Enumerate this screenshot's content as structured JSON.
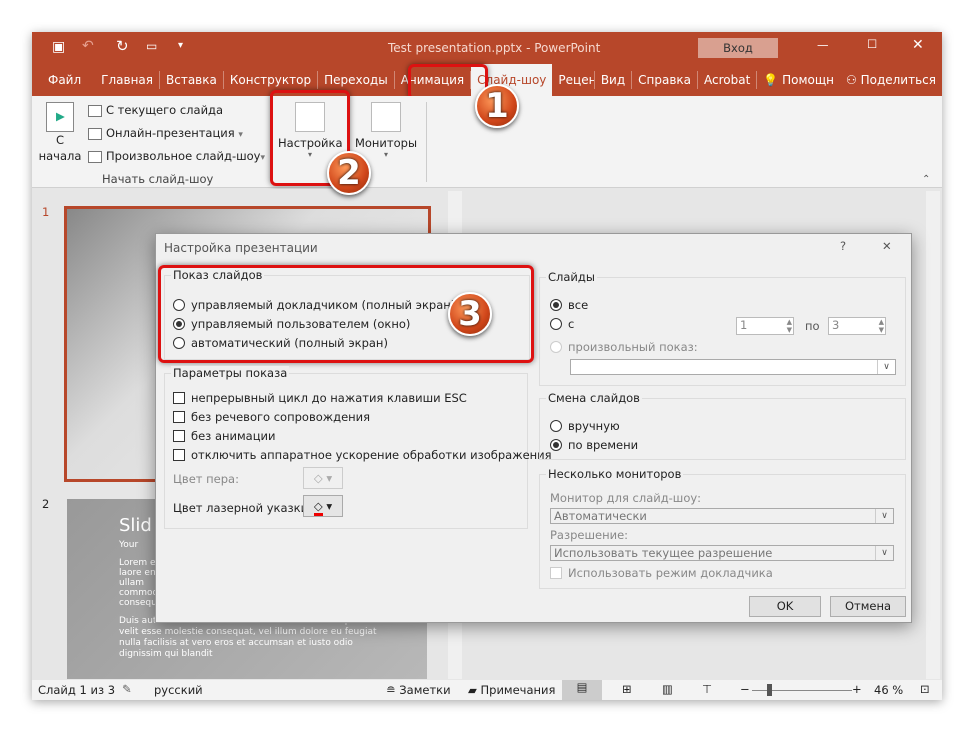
{
  "window": {
    "title": "Test presentation.pptx  -  PowerPoint",
    "login_button": "Вход"
  },
  "tabs": [
    "Файл",
    "Главная",
    "Вставка",
    "Конструктор",
    "Переходы",
    "Анимация",
    "Слайд-шоу",
    "Рецензирование",
    "Вид",
    "Справка",
    "Acrobat",
    "Помощн",
    "Поделиться"
  ],
  "ribbon": {
    "from_start": "С начала",
    "from_current": "С текущего слайда",
    "online": "Онлайн-презентация",
    "custom": "Произвольное слайд-шоу",
    "group_label": "Начать слайд-шоу",
    "setup": "Настройка",
    "monitors": "Мониторы"
  },
  "badges": [
    "1",
    "2",
    "3"
  ],
  "thumbs": {
    "n1": "1",
    "n2": "2",
    "slide2_title": "Slid",
    "slide2_b1": "Your",
    "slide2_b2": "Lorem elit, laore enim ullam commodo consequat",
    "slide2_b3": "Duis autem vel eum iriure dolor in hendrerit in vulputate velit esse molestie consequat, vel illum dolore eu feugiat nulla facilisis at vero eros et accumsan et iusto odio dignissim qui blandit"
  },
  "dialog": {
    "title": "Настройка презентации",
    "help": "?",
    "close": "✕",
    "show_type": {
      "label": "Показ слайдов",
      "options": [
        "управляемый докладчиком (полный экран)",
        "управляемый пользователем (окно)",
        "автоматический (полный экран)"
      ],
      "selected": 1
    },
    "options": {
      "label": "Параметры показа",
      "items": [
        "непрерывный цикл до нажатия клавиши ESC",
        "без речевого сопровождения",
        "без анимации",
        "отключить аппаратное ускорение обработки изображения"
      ],
      "pen_color": "Цвет пера:",
      "laser_color": "Цвет лазерной указки:"
    },
    "slides": {
      "label": "Слайды",
      "all": "все",
      "from": "с",
      "from_value": "1",
      "to": "по",
      "to_value": "3",
      "custom": "произвольный показ:"
    },
    "advance": {
      "label": "Смена слайдов",
      "manual": "вручную",
      "timings": "по времени"
    },
    "monitors": {
      "label": "Несколько мониторов",
      "monitor_label": "Монитор для слайд-шоу:",
      "monitor_value": "Автоматически",
      "resolution_label": "Разрешение:",
      "resolution_value": "Использовать текущее разрешение",
      "presenter_view": "Использовать режим докладчика"
    },
    "ok": "OK",
    "cancel": "Отмена"
  },
  "status": {
    "slide": "Слайд 1 из 3",
    "language": "русский",
    "notes": "Заметки",
    "comments": "Примечания",
    "zoom": "46 %"
  },
  "colors": {
    "accent": "#b7472a",
    "highlight": "#dd1111"
  }
}
